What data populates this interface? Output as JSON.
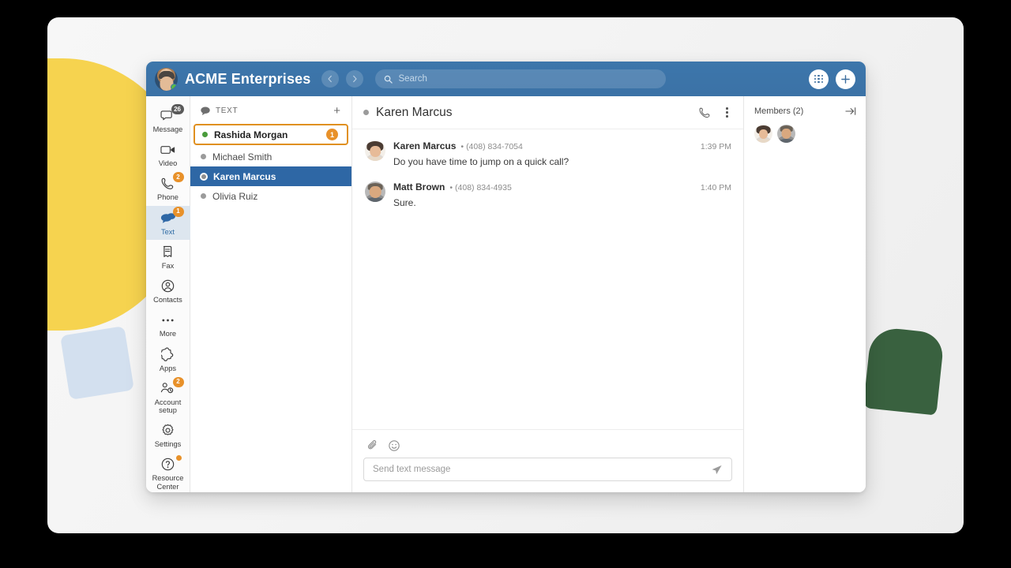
{
  "header": {
    "org_title": "ACME Enterprises",
    "avatar_name": "user-avatar",
    "presence": "online",
    "back_icon": "chevron-left-icon",
    "forward_icon": "chevron-right-icon",
    "search_placeholder": "Search",
    "search_value": "",
    "search_icon": "search-icon",
    "dialpad_label": "dialpad",
    "plus_label": "+"
  },
  "rail": {
    "items": [
      {
        "label": "Message",
        "icon": "message-icon",
        "badge": "26",
        "badge_style": "gray",
        "active": false
      },
      {
        "label": "Video",
        "icon": "video-icon",
        "badge": "",
        "badge_style": "",
        "active": false
      },
      {
        "label": "Phone",
        "icon": "phone-icon",
        "badge": "2",
        "badge_style": "orange",
        "active": false
      },
      {
        "label": "Text",
        "icon": "text-icon",
        "badge": "1",
        "badge_style": "orange",
        "active": true
      },
      {
        "label": "Fax",
        "icon": "fax-icon",
        "badge": "",
        "badge_style": "",
        "active": false
      },
      {
        "label": "Contacts",
        "icon": "contacts-icon",
        "badge": "",
        "badge_style": "",
        "active": false
      },
      {
        "label": "More",
        "icon": "more-icon",
        "badge": "",
        "badge_style": "",
        "active": false
      }
    ],
    "bottom_items": [
      {
        "label": "Apps",
        "icon": "apps-icon",
        "badge": "",
        "badge_style": ""
      },
      {
        "label": "Account\nsetup",
        "icon": "account-setup-icon",
        "badge": "2",
        "badge_style": "orange"
      },
      {
        "label": "Settings",
        "icon": "settings-icon",
        "badge": "",
        "badge_style": ""
      },
      {
        "label": "Resource\nCenter",
        "icon": "help-icon",
        "badge": "·",
        "badge_style": "orange-dot"
      }
    ]
  },
  "conversations": {
    "section_title": "TEXT",
    "section_icon": "speech-bubble-icon",
    "add_label": "+",
    "items": [
      {
        "name": "Rashida Morgan",
        "presence": "online",
        "unread": "1",
        "state": "highlight"
      },
      {
        "name": "Michael Smith",
        "presence": "offline",
        "unread": "",
        "state": ""
      },
      {
        "name": "Karen Marcus",
        "presence": "ring",
        "unread": "",
        "state": "selected"
      },
      {
        "name": "Olivia Ruiz",
        "presence": "offline",
        "unread": "",
        "state": ""
      }
    ]
  },
  "thread": {
    "title": "Karen Marcus",
    "presence": "offline",
    "call_icon": "phone-icon",
    "menu_icon": "kebab-menu-icon",
    "messages": [
      {
        "sender": "Karen Marcus",
        "phone": "(408) 834-7054",
        "time": "1:39 PM",
        "text": "Do you have time to jump on a quick call?",
        "avatar": "av-a"
      },
      {
        "sender": "Matt Brown",
        "phone": "(408) 834-4935",
        "time": "1:40 PM",
        "text": "Sure.",
        "avatar": "av-b"
      }
    ]
  },
  "composer": {
    "attach_icon": "paperclip-icon",
    "emoji_icon": "emoji-icon",
    "placeholder": "Send text message",
    "value": "",
    "send_icon": "send-icon"
  },
  "members": {
    "title": "Members (2)",
    "collapse_icon": "collapse-right-icon",
    "avatars": [
      "av-a",
      "av-b"
    ]
  },
  "colors": {
    "topbar": "#3d76ab",
    "selected_row": "#2e67a5",
    "highlight_border": "#e09020",
    "badge_orange": "#e8912a",
    "badge_gray": "#5a5a5a",
    "presence_online": "#4a9b3c",
    "deco_yellow": "#f6d34f",
    "deco_blue": "#d3e0ef",
    "deco_green": "#39613f"
  }
}
